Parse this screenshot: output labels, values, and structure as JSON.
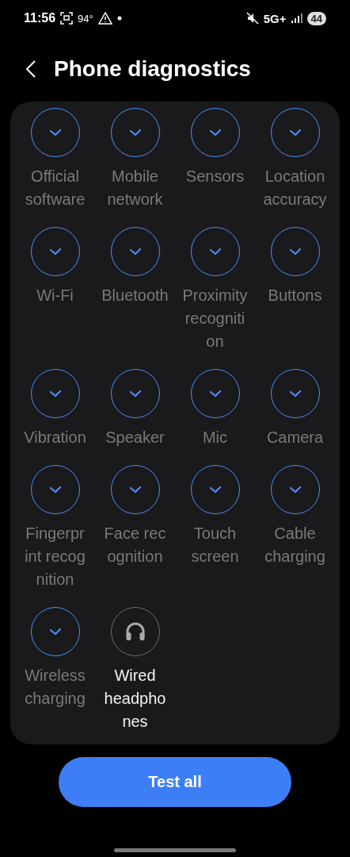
{
  "status_bar": {
    "time": "11:56",
    "temperature": "94°",
    "network": "5G+",
    "battery": "44"
  },
  "header": {
    "title": "Phone diagnostics"
  },
  "tests": [
    {
      "lines": [
        "Official",
        "software"
      ],
      "checked": true
    },
    {
      "lines": [
        "Mobile",
        "network"
      ],
      "checked": true
    },
    {
      "lines": [
        "Sensors"
      ],
      "checked": true
    },
    {
      "lines": [
        "Location",
        "accuracy"
      ],
      "checked": true
    },
    {
      "lines": [
        "Wi-Fi"
      ],
      "checked": true
    },
    {
      "lines": [
        "Bluetooth"
      ],
      "checked": true
    },
    {
      "lines": [
        "Proximity",
        "recogniti",
        "on"
      ],
      "checked": true
    },
    {
      "lines": [
        "Buttons"
      ],
      "checked": true
    },
    {
      "lines": [
        "Vibration"
      ],
      "checked": true
    },
    {
      "lines": [
        "Speaker"
      ],
      "checked": true
    },
    {
      "lines": [
        "Mic"
      ],
      "checked": true
    },
    {
      "lines": [
        "Camera"
      ],
      "checked": true
    },
    {
      "lines": [
        "Fingerpr",
        "int recog",
        "nition"
      ],
      "checked": true
    },
    {
      "lines": [
        "Face rec",
        "ognition"
      ],
      "checked": true
    },
    {
      "lines": [
        "Touch",
        "screen"
      ],
      "checked": true
    },
    {
      "lines": [
        "Cable",
        "charging"
      ],
      "checked": true
    },
    {
      "lines": [
        "Wireless",
        "charging"
      ],
      "checked": true
    },
    {
      "lines": [
        "Wired",
        "headpho",
        "nes"
      ],
      "checked": false
    }
  ],
  "button": "Test all"
}
